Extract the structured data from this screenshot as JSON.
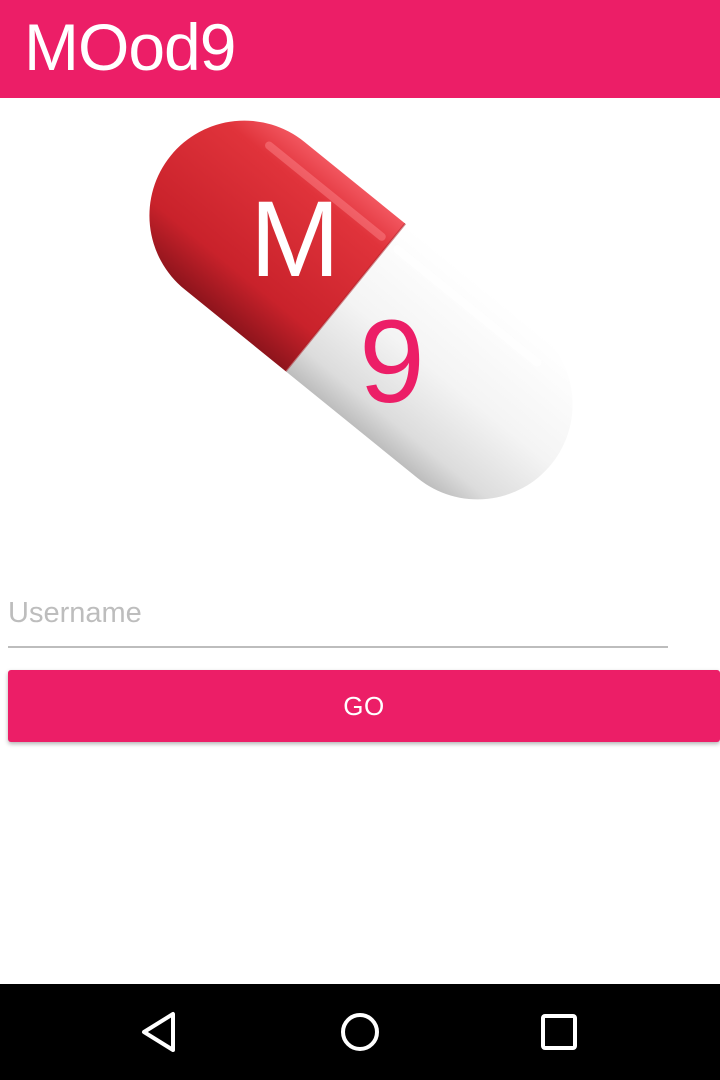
{
  "app_bar": {
    "title": "MOod9",
    "color": "#EC1E67"
  },
  "logo": {
    "icon": "capsule-pill-icon",
    "letter_top": "M",
    "letter_bottom": "9",
    "red_color": "#D4262F",
    "white_color": "#F2F2F2",
    "letter_bottom_color": "#EC1E67"
  },
  "login": {
    "username_placeholder": "Username",
    "username_value": "",
    "go_label": "GO",
    "button_color": "#EC1E67"
  },
  "nav_bar": {
    "back_icon": "back-triangle-icon",
    "home_icon": "home-circle-icon",
    "recents_icon": "recents-square-icon"
  }
}
